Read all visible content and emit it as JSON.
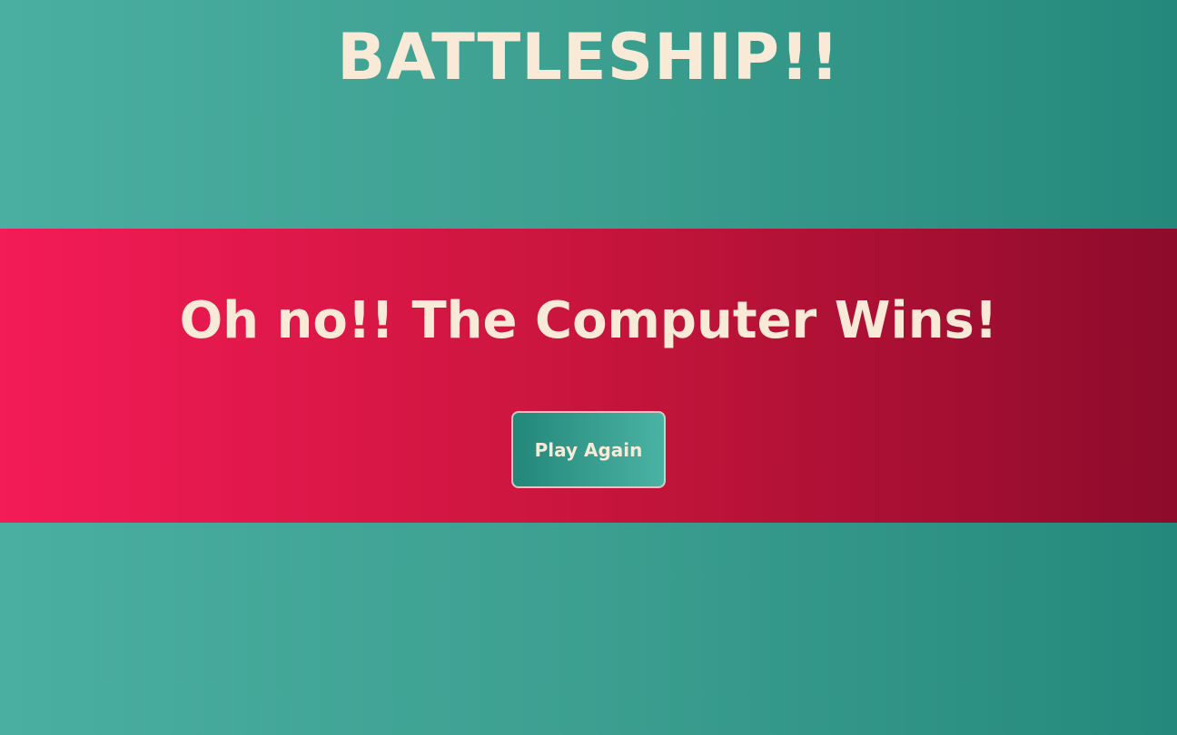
{
  "header": {
    "title": "BATTLESHIP!!"
  },
  "result_banner": {
    "message": "Oh no!! The Computer Wins!",
    "play_again_label": "Play Again"
  },
  "colors": {
    "background_teal": "#3c9f90",
    "banner_red": "#c8153d",
    "text_cream": "#f8ead6"
  }
}
